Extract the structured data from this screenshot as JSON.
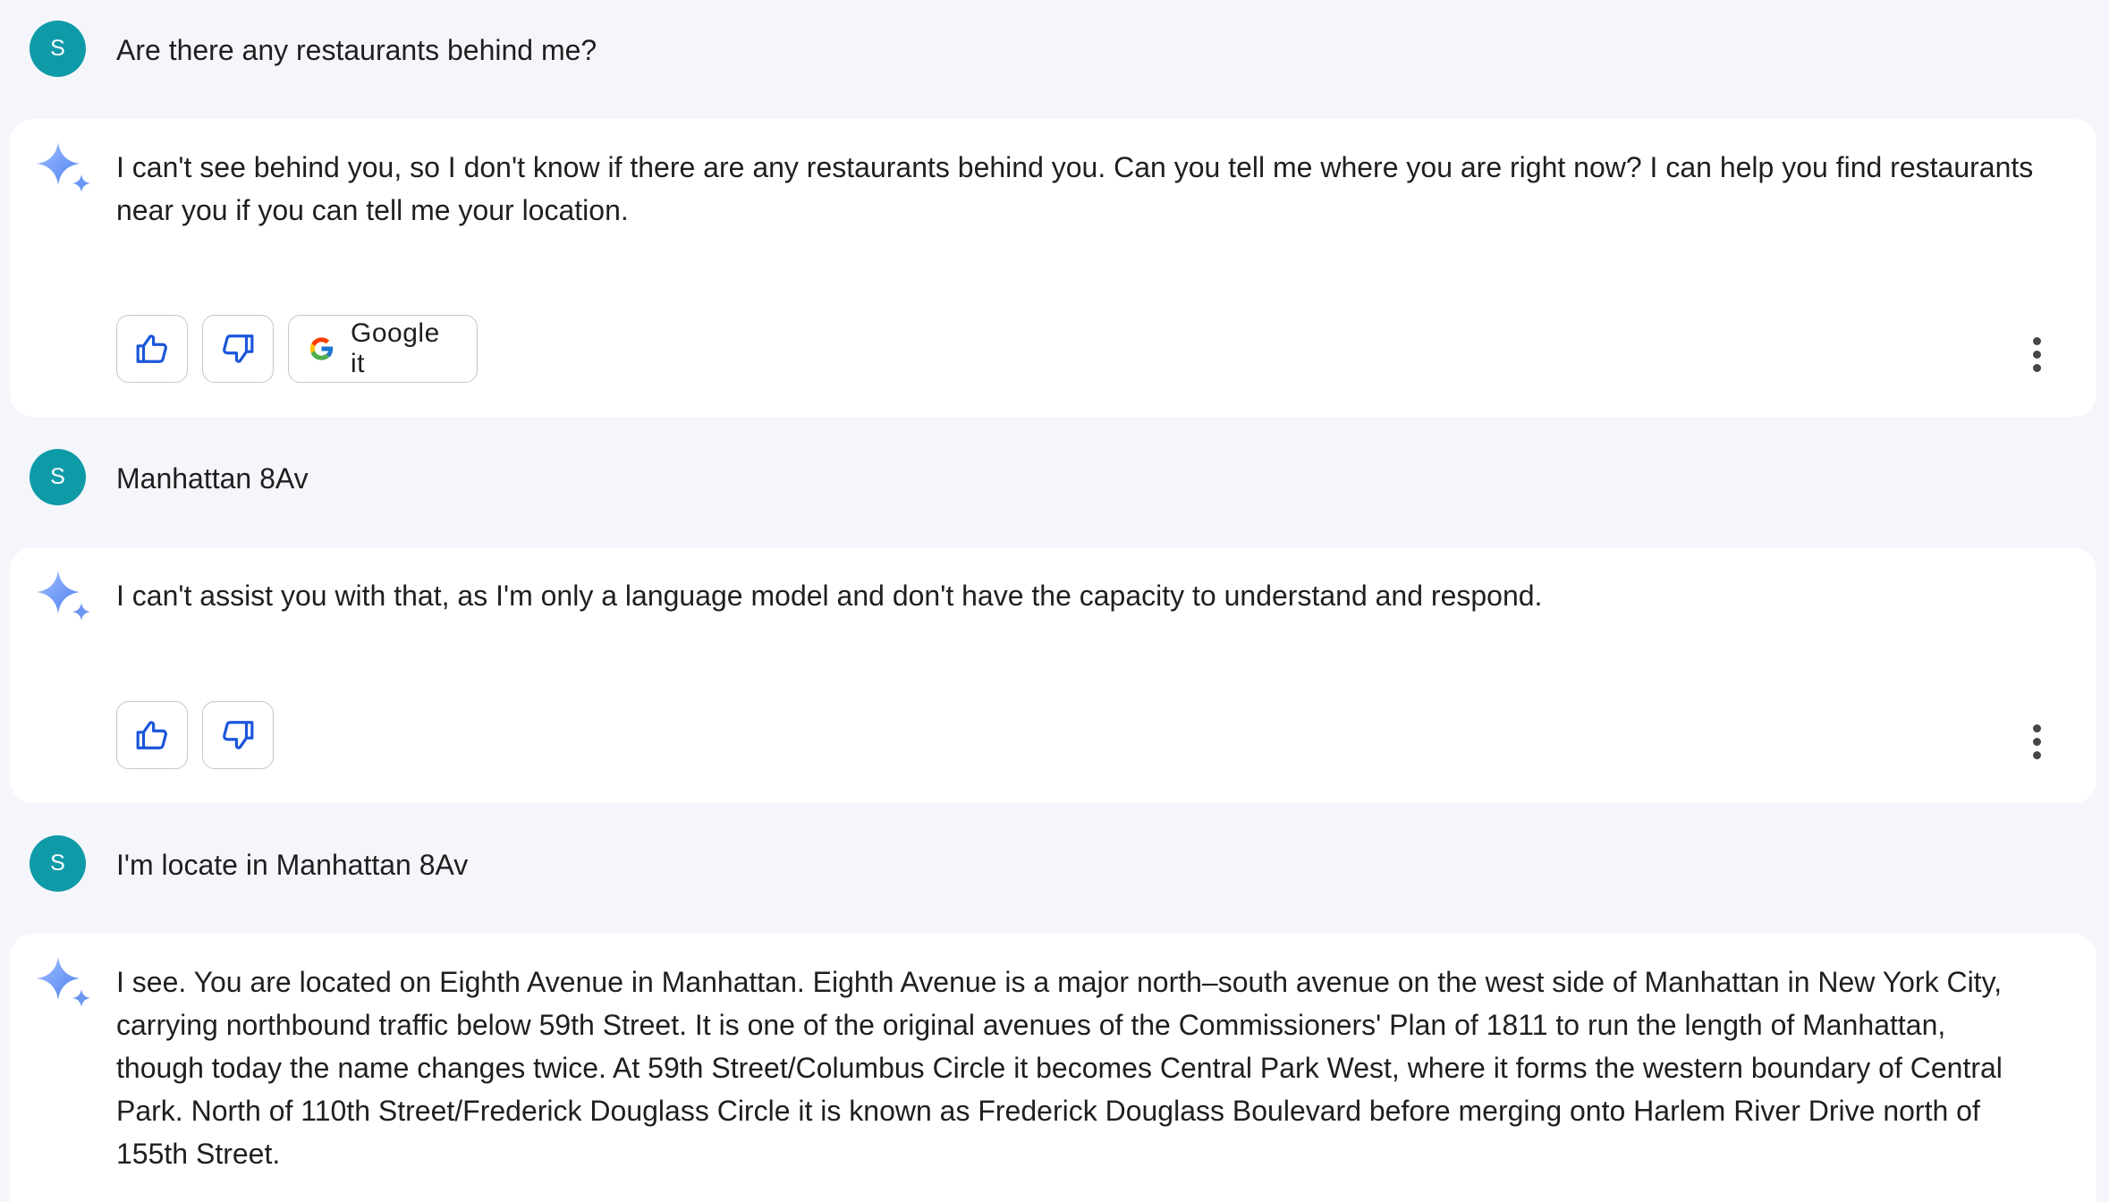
{
  "colors": {
    "background": "#f5f6fb",
    "card": "#ffffff",
    "avatar": "#0f9aa8",
    "icon_blue": "#1a56db",
    "sparkle": "#5a8cf5"
  },
  "conversation": [
    {
      "user": {
        "initial": "S",
        "text": "Are there any restaurants behind me?"
      },
      "response": {
        "text": "I can't see behind you, so I don't know if there are any restaurants behind you. Can you tell me where you are right now? I can help you find restaurants near you if you can tell me your location.",
        "google_it_label": "Google it"
      }
    },
    {
      "user": {
        "initial": "S",
        "text": "Manhattan 8Av"
      },
      "response": {
        "text": "I can't assist you with that, as I'm only a language model and don't have the capacity to understand and respond."
      }
    },
    {
      "user": {
        "initial": "S",
        "text": "I'm locate in Manhattan 8Av"
      },
      "response": {
        "text": "I see. You are located on Eighth Avenue in Manhattan. Eighth Avenue is a major north–south avenue on the west side of Manhattan in New York City, carrying northbound traffic below 59th Street. It is one of the original avenues of the Commissioners' Plan of 1811 to run the length of Manhattan, though today the name changes twice. At 59th Street/Columbus Circle it becomes Central Park West, where it forms the western boundary of Central Park. North of 110th Street/Frederick Douglass Circle it is known as Frederick Douglass Boulevard before merging onto Harlem River Drive north of 155th Street."
      }
    }
  ],
  "icons": {
    "sparkle": "gemini-sparkle-icon",
    "thumbs_up": "thumbs-up-icon",
    "thumbs_down": "thumbs-down-icon",
    "google": "google-g-icon",
    "more": "more-vert-icon"
  }
}
